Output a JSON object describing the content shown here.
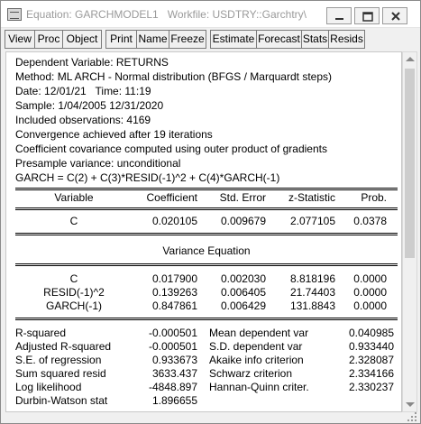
{
  "window": {
    "title": "Equation: GARCHMODEL1   Workfile: USDTRY::Garchtry\\"
  },
  "toolbar": {
    "buttons": [
      "View",
      "Proc",
      "Object",
      "Print",
      "Name",
      "Freeze",
      "Estimate",
      "Forecast",
      "Stats",
      "Resids"
    ]
  },
  "header_lines": [
    "Dependent Variable: RETURNS",
    "Method: ML ARCH - Normal distribution (BFGS / Marquardt steps)",
    "Date: 12/01/21   Time: 11:19",
    "Sample: 1/04/2005 12/31/2020",
    "Included observations: 4169",
    "Convergence achieved after 19 iterations",
    "Coefficient covariance computed using outer product of gradients",
    "Presample variance: unconditional",
    "GARCH = C(2) + C(3)*RESID(-1)^2 + C(4)*GARCH(-1)"
  ],
  "table_header": {
    "variable": "Variable",
    "coefficient": "Coefficient",
    "std_error": "Std. Error",
    "z_statistic": "z-Statistic",
    "prob": "Prob."
  },
  "mean_rows": [
    {
      "variable": "C",
      "coefficient": "0.020105",
      "std_error": "0.009679",
      "z_statistic": "2.077105",
      "prob": "0.0378"
    }
  ],
  "variance_section_title": "Variance Equation",
  "variance_rows": [
    {
      "variable": "C",
      "coefficient": "0.017900",
      "std_error": "0.002030",
      "z_statistic": "8.818196",
      "prob": "0.0000"
    },
    {
      "variable": "RESID(-1)^2",
      "coefficient": "0.139263",
      "std_error": "0.006405",
      "z_statistic": "21.74403",
      "prob": "0.0000"
    },
    {
      "variable": "GARCH(-1)",
      "coefficient": "0.847861",
      "std_error": "0.006429",
      "z_statistic": "131.8843",
      "prob": "0.0000"
    }
  ],
  "stats_rows": [
    {
      "label1": "R-squared",
      "value1": "-0.000501",
      "label2": "Mean dependent var",
      "value2": "0.040985"
    },
    {
      "label1": "Adjusted R-squared",
      "value1": "-0.000501",
      "label2": "S.D. dependent var",
      "value2": "0.933440"
    },
    {
      "label1": "S.E. of regression",
      "value1": "0.933673",
      "label2": "Akaike info criterion",
      "value2": "2.328087"
    },
    {
      "label1": "Sum squared resid",
      "value1": "3633.437",
      "label2": "Schwarz criterion",
      "value2": "2.334166"
    },
    {
      "label1": "Log likelihood",
      "value1": "-4848.897",
      "label2": "Hannan-Quinn criter.",
      "value2": "2.330237"
    },
    {
      "label1": "Durbin-Watson stat",
      "value1": "1.896655",
      "label2": "",
      "value2": ""
    }
  ]
}
